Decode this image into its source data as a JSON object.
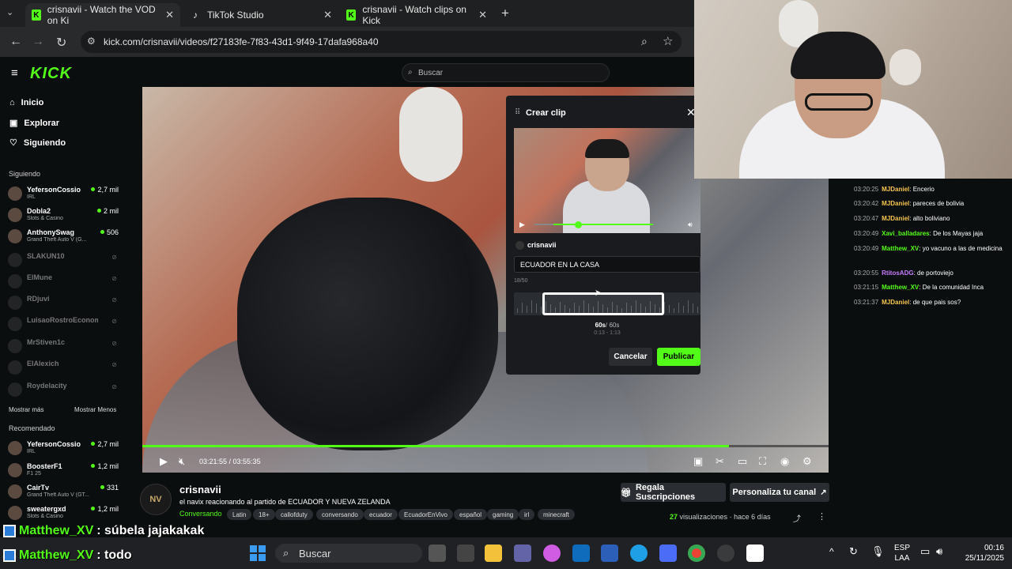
{
  "browser": {
    "tabs": [
      {
        "label": "crisnavii - Watch the VOD on Ki"
      },
      {
        "label": "TikTok Studio"
      },
      {
        "label": "crisnavii - Watch clips on Kick"
      }
    ],
    "url": "kick.com/crisnavii/videos/f27183fe-7f83-43d1-9f49-17dafa968a40"
  },
  "header": {
    "logo": "KICK",
    "search_placeholder": "Buscar"
  },
  "sidebar": {
    "nav": [
      {
        "label": "Inicio"
      },
      {
        "label": "Explorar"
      },
      {
        "label": "Siguiendo"
      }
    ],
    "following_title": "Siguiendo",
    "following": [
      {
        "name": "YefersonCossio",
        "sub": "IRL",
        "viewers": "2,7 mil"
      },
      {
        "name": "Dobla2",
        "sub": "Slots & Casino",
        "viewers": "2 mil"
      },
      {
        "name": "AnthonySwag",
        "sub": "Grand Theft Auto V (G...",
        "viewers": "506"
      }
    ],
    "offline": [
      {
        "name": "SLAKUN10"
      },
      {
        "name": "ElMune"
      },
      {
        "name": "RDjuvi"
      },
      {
        "name": "LuisaoRostroEconomi..."
      },
      {
        "name": "MrStiven1c"
      },
      {
        "name": "ElAlexich"
      },
      {
        "name": "Roydelacity"
      }
    ],
    "show_more": "Mostrar más",
    "show_less": "Mostrar Menos",
    "recommended_title": "Recomendado",
    "recommended": [
      {
        "name": "YefersonCossio",
        "sub": "IRL",
        "viewers": "2,7 mil"
      },
      {
        "name": "BoosterF1",
        "sub": "F1 25",
        "viewers": "1,2 mil"
      },
      {
        "name": "CairTv",
        "sub": "Grand Theft Auto V (GT...",
        "viewers": "331"
      },
      {
        "name": "sweatergxd",
        "sub": "Slots & Casino",
        "viewers": "1,2 mil"
      }
    ]
  },
  "player": {
    "time": "03:21:55 / 03:55:35",
    "progress": 0.855
  },
  "clip_modal": {
    "title": "Crear clip",
    "author": "crisnavii",
    "clip_title": "ECUADOR EN LA CASA",
    "char_count": "18/50",
    "duration": "60s",
    "duration_max": "/ 60s",
    "range": "0:13 - 1:13",
    "cancel": "Cancelar",
    "publish": "Publicar"
  },
  "chat": [
    {
      "ts": "03:20:25",
      "user": "MJDaniel",
      "color": "#f6c64f",
      "text": "Encerio"
    },
    {
      "ts": "03:20:42",
      "user": "MJDaniel",
      "color": "#f6c64f",
      "text": "pareces de bolivia"
    },
    {
      "ts": "03:20:47",
      "user": "MJDaniel",
      "color": "#f6c64f",
      "text": "alto boliviano"
    },
    {
      "ts": "03:20:49",
      "user": "Xavi_balladares",
      "color": "#53fc18",
      "text": "De los Mayas jaja"
    },
    {
      "ts": "03:20:49",
      "user": "Matthew_XV",
      "color": "#53fc18",
      "text": "yo vacuno a las de medicina"
    },
    {
      "ts": "03:20:55",
      "user": "RtitosADG",
      "color": "#c77dff",
      "text": "de portoviejo"
    },
    {
      "ts": "03:21:15",
      "user": "Matthew_XV",
      "color": "#53fc18",
      "text": "De la comunidad Inca"
    },
    {
      "ts": "03:21:37",
      "user": "MJDaniel",
      "color": "#f6c64f",
      "text": "de que pais sos?"
    }
  ],
  "stream_info": {
    "avatar_text": "NV",
    "channel": "crisnavii",
    "title": "el navix reacionando al partido  de  ECUADOR Y NUEVA ZELANDA",
    "category": "Conversando",
    "tags": [
      "Latin",
      "18+",
      "callofduty",
      "conversando",
      "ecuador",
      "EcuadorEnVivo",
      "español",
      "gaming",
      "irl",
      "minecraft"
    ],
    "subs_button": "Regala Suscripciones",
    "customize_button": "Personaliza tu canal",
    "views_count": "27",
    "views_label": "visualizaciones",
    "ago": "hace 6 días"
  },
  "overlay_chat": [
    {
      "user": "Matthew_XV",
      "text": ": súbela jajakakak"
    },
    {
      "user": "Matthew_XV",
      "text": ": todo"
    }
  ],
  "taskbar": {
    "search": "Buscar",
    "lang1": "ESP",
    "lang2": "LAA",
    "time": "00:16",
    "date": "25/11/2025"
  },
  "colors": {
    "accent": "#53fc18",
    "bg": "#0b0e0f"
  }
}
